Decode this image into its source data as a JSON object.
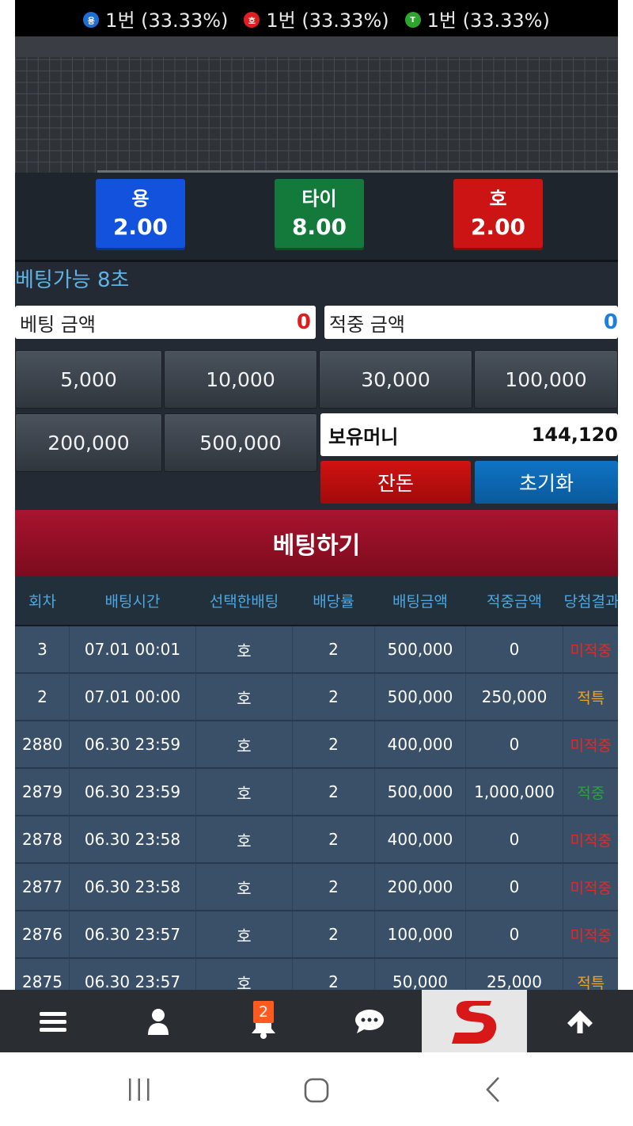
{
  "stats": [
    {
      "icon": "용",
      "color": "#1f6ed4",
      "text": "1번 (33.33%)"
    },
    {
      "icon": "호",
      "color": "#e02020",
      "text": "1번 (33.33%)"
    },
    {
      "icon": "T",
      "color": "#2ea52e",
      "text": "1번 (33.33%)"
    }
  ],
  "bets": [
    {
      "name": "용",
      "odds": "2.00"
    },
    {
      "name": "타이",
      "odds": "8.00"
    },
    {
      "name": "호",
      "odds": "2.00"
    }
  ],
  "timer": "베팅가능 8초",
  "bet_amount": {
    "label": "베팅 금액",
    "value": "0"
  },
  "win_amount": {
    "label": "적중 금액",
    "value": "0"
  },
  "chips": [
    "5,000",
    "10,000",
    "30,000",
    "100,000",
    "200,000",
    "500,000"
  ],
  "money": {
    "label": "보유머니",
    "value": "144,120"
  },
  "buttons": {
    "balance": "잔돈",
    "reset": "초기화",
    "place": "베팅하기"
  },
  "table": {
    "headers": [
      "회차",
      "배팅시간",
      "선택한배팅",
      "배당률",
      "배팅금액",
      "적중금액",
      "당첨결과"
    ],
    "rows": [
      [
        "3",
        "07.01 00:01",
        "호",
        "2",
        "500,000",
        "0",
        "미적중"
      ],
      [
        "2",
        "07.01 00:00",
        "호",
        "2",
        "500,000",
        "250,000",
        "적특"
      ],
      [
        "2880",
        "06.30 23:59",
        "호",
        "2",
        "400,000",
        "0",
        "미적중"
      ],
      [
        "2879",
        "06.30 23:59",
        "호",
        "2",
        "500,000",
        "1,000,000",
        "적중"
      ],
      [
        "2878",
        "06.30 23:58",
        "호",
        "2",
        "400,000",
        "0",
        "미적중"
      ],
      [
        "2877",
        "06.30 23:58",
        "호",
        "2",
        "200,000",
        "0",
        "미적중"
      ],
      [
        "2876",
        "06.30 23:57",
        "호",
        "2",
        "100,000",
        "0",
        "미적중"
      ],
      [
        "2875",
        "06.30 23:57",
        "호",
        "2",
        "50,000",
        "25,000",
        "적특"
      ]
    ],
    "result_colors": {
      "미적중": "#e02a2a",
      "적특": "#f0a41e",
      "적중": "#2aa33a"
    }
  },
  "nav": {
    "badge": "2",
    "icons": [
      "menu-icon",
      "user-icon",
      "bell-icon",
      "chat-icon",
      "logo-icon",
      "arrow-up-icon"
    ]
  }
}
